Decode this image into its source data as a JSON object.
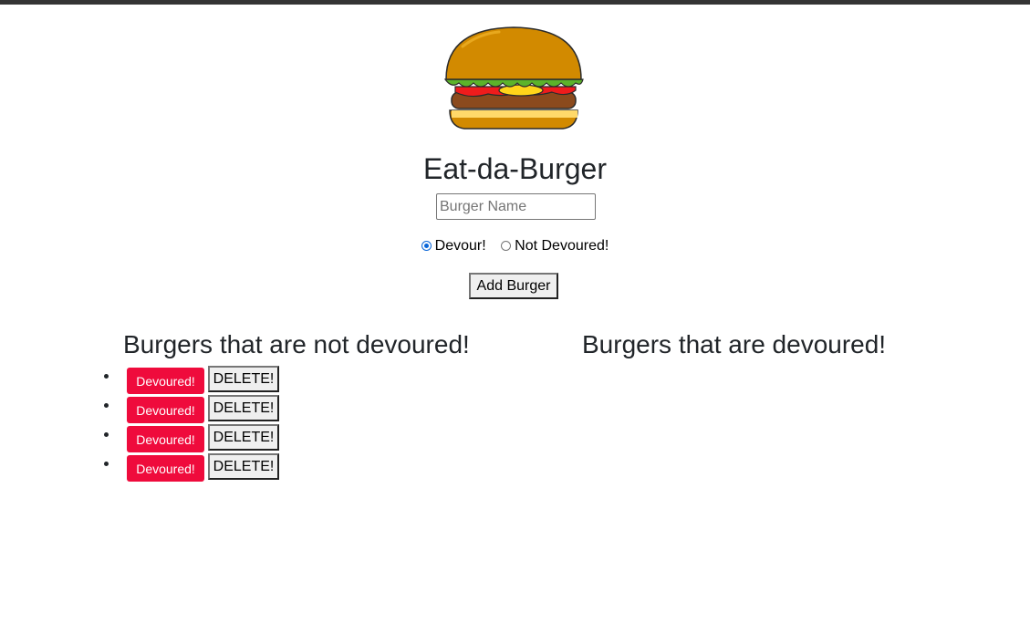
{
  "header": {
    "title": "Eat-da-Burger",
    "logo": "burger-icon"
  },
  "form": {
    "name_placeholder": "Burger Name",
    "name_value": "",
    "radio_options": [
      {
        "label": "Devour!",
        "checked": true
      },
      {
        "label": "Not Devoured!",
        "checked": false
      }
    ],
    "submit_label": "Add Burger"
  },
  "columns": {
    "not_devoured_heading": "Burgers that are not devoured!",
    "devoured_heading": "Burgers that are devoured!"
  },
  "not_devoured_items": [
    {
      "devour_label": "Devoured!",
      "delete_label": "DELETE!"
    },
    {
      "devour_label": "Devoured!",
      "delete_label": "DELETE!"
    },
    {
      "devour_label": "Devoured!",
      "delete_label": "DELETE!"
    },
    {
      "devour_label": "Devoured!",
      "delete_label": "DELETE!"
    }
  ],
  "devoured_items": [],
  "colors": {
    "devour_button": "#ef0b3c",
    "bun": "#d28a00",
    "lettuce": "#5cb32a",
    "tomato": "#ef1c1c",
    "cheese": "#ffd51a",
    "patty": "#8b4a1d"
  }
}
